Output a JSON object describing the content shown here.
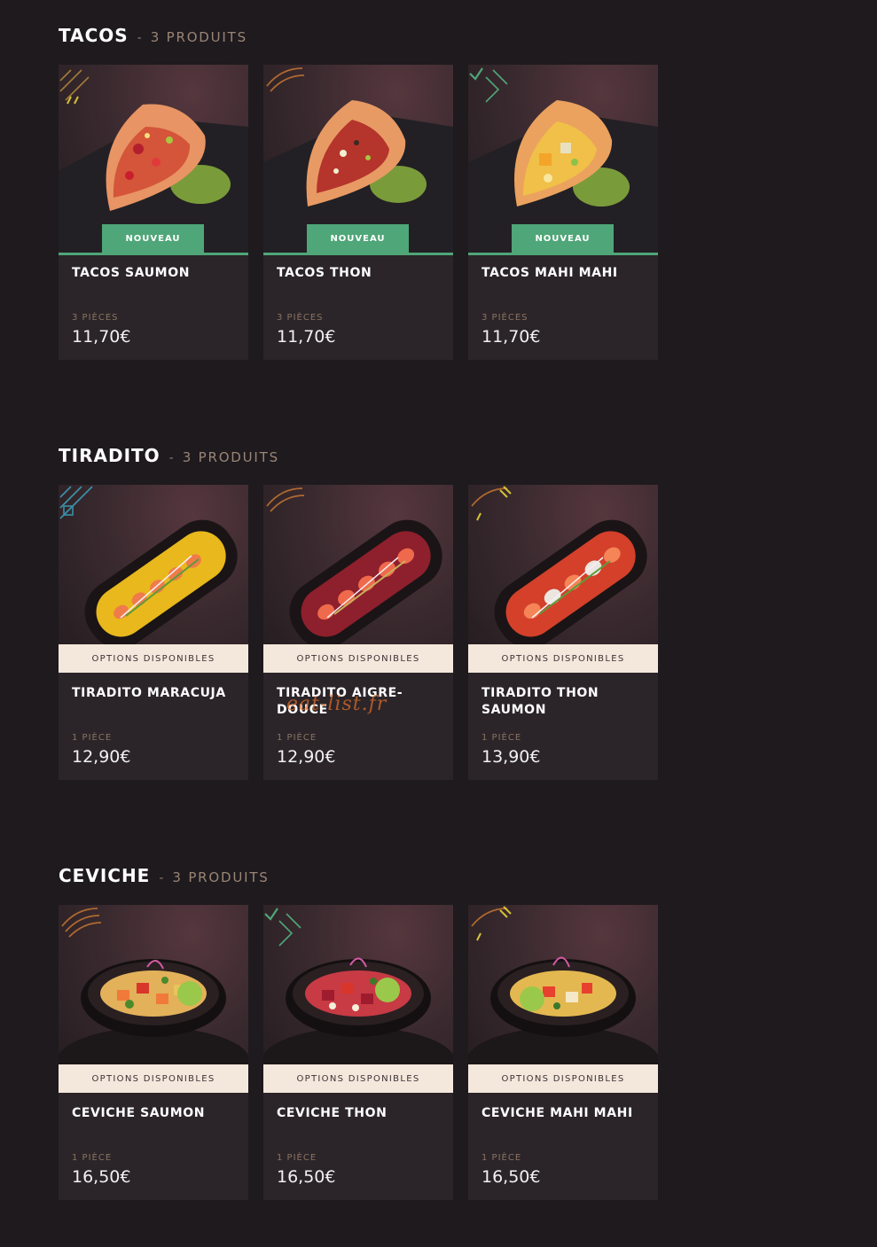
{
  "sections": [
    {
      "title": "TACOS",
      "separator": "-",
      "count": "3 PRODUITS",
      "items": [
        {
          "badge": "NOUVEAU",
          "name": "TACOS SAUMON",
          "qty": "3 PIÈCES",
          "price": "11,70€"
        },
        {
          "badge": "NOUVEAU",
          "name": "TACOS THON",
          "qty": "3 PIÈCES",
          "price": "11,70€"
        },
        {
          "badge": "NOUVEAU",
          "name": "TACOS MAHI MAHI",
          "qty": "3 PIÈCES",
          "price": "11,70€"
        }
      ]
    },
    {
      "title": "TIRADITO",
      "separator": "-",
      "count": "3 PRODUITS",
      "items": [
        {
          "badge": "OPTIONS DISPONIBLES",
          "name": "TIRADITO MARACUJA",
          "qty": "1 PIÈCE",
          "price": "12,90€"
        },
        {
          "badge": "OPTIONS DISPONIBLES",
          "name": "TIRADITO AIGRE-DOUCE",
          "qty": "1 PIÈCE",
          "price": "12,90€"
        },
        {
          "badge": "OPTIONS DISPONIBLES",
          "name": "TIRADITO THON SAUMON",
          "qty": "1 PIÈCE",
          "price": "13,90€"
        }
      ]
    },
    {
      "title": "CEVICHE",
      "separator": "-",
      "count": "3 PRODUITS",
      "items": [
        {
          "badge": "OPTIONS DISPONIBLES",
          "name": "CEVICHE SAUMON",
          "qty": "1 PIÈCE",
          "price": "16,50€"
        },
        {
          "badge": "OPTIONS DISPONIBLES",
          "name": "CEVICHE THON",
          "qty": "1 PIÈCE",
          "price": "16,50€"
        },
        {
          "badge": "OPTIONS DISPONIBLES",
          "name": "CEVICHE MAHI MAHI",
          "qty": "1 PIÈCE",
          "price": "16,50€"
        }
      ]
    }
  ],
  "watermark": "eat-list.fr",
  "colors": {
    "background": "#1e1a1e",
    "card": "#2b2529",
    "badge_new": "#4fa678",
    "badge_options": "#f4e8dc",
    "qty_text": "#8a7462"
  }
}
